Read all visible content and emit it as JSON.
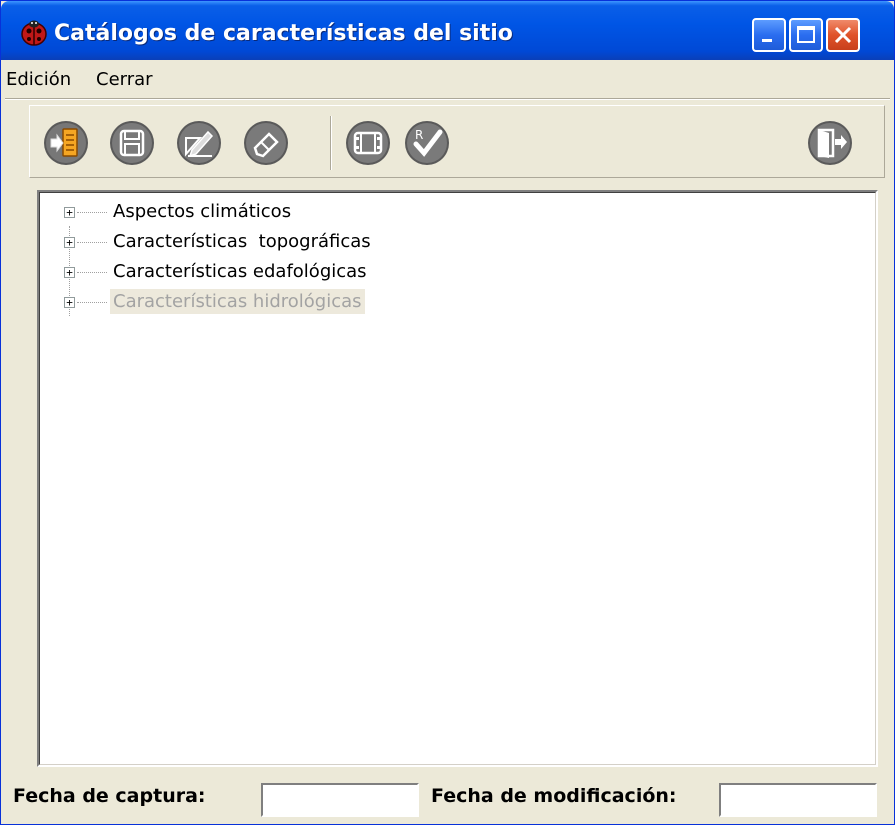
{
  "window": {
    "title": "Catálogos de características del sitio",
    "icons": {
      "app": "ladybug-icon",
      "minimize": "minimize-icon",
      "maximize": "maximize-icon",
      "close": "close-icon"
    }
  },
  "menubar": {
    "items": [
      "Edición",
      "Cerrar"
    ]
  },
  "toolbar": {
    "buttons": [
      {
        "icon": "new-document-icon"
      },
      {
        "icon": "save-icon"
      },
      {
        "icon": "edit-pencil-icon"
      },
      {
        "icon": "eraser-icon"
      },
      {
        "icon": "film-icon"
      },
      {
        "icon": "spellcheck-icon"
      },
      {
        "icon": "exit-door-icon"
      }
    ]
  },
  "tree": {
    "items": [
      {
        "label": "Aspectos climáticos",
        "expander": "+"
      },
      {
        "label": "Características  topográficas",
        "expander": "+"
      },
      {
        "label": "Características edafológicas",
        "expander": "+"
      },
      {
        "label": "Características hidrológicas",
        "expander": "+",
        "state": "disabled"
      }
    ]
  },
  "footer": {
    "capture_label": "Fecha de captura:",
    "capture_value": "",
    "modified_label": "Fecha de modificación:",
    "modified_value": ""
  },
  "colors": {
    "titlebar": "#0055e5",
    "window_bg": "#ece9d8",
    "close_button": "#e0532a"
  }
}
